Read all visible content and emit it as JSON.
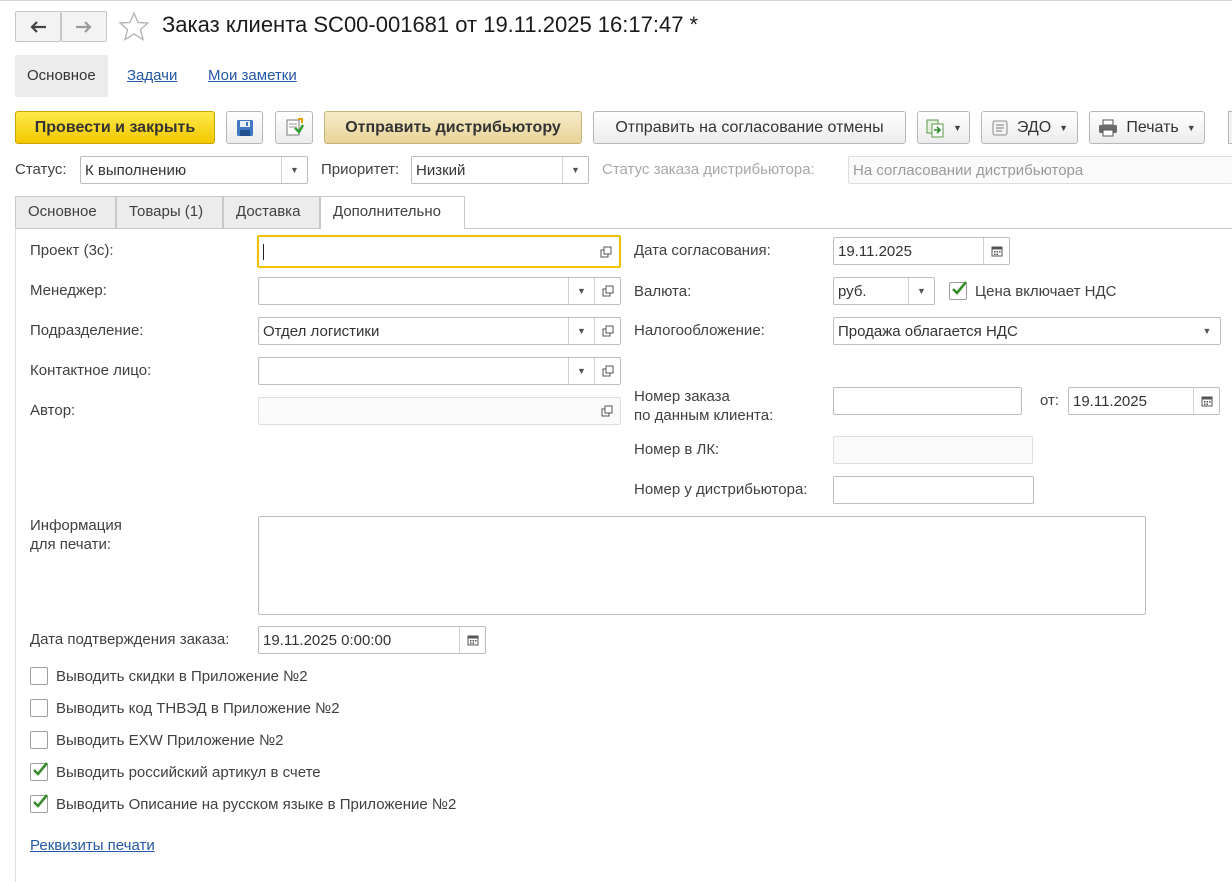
{
  "window": {
    "title": "Заказ клиента SC00-001681 от 19.11.2025 16:17:47 *"
  },
  "nav": {
    "back_icon": "arrow-left-icon",
    "forward_icon": "arrow-right-icon",
    "favorite_icon": "star-icon"
  },
  "sections": {
    "main": "Основное",
    "tasks": "Задачи",
    "notes": "Мои заметки"
  },
  "toolbar": {
    "post_close": "Провести и закрыть",
    "send_distributor": "Отправить дистрибьютору",
    "send_cancel_approval": "Отправить на согласование отмены",
    "edo": "ЭДО",
    "print": "Печать"
  },
  "header": {
    "status_label": "Статус:",
    "status_value": "К выполнению",
    "priority_label": "Приоритет:",
    "priority_value": "Низкий",
    "dist_status_label": "Статус заказа дистрибьютора:",
    "dist_status_value": "На согласовании дистрибьютора"
  },
  "tabs": [
    {
      "label": "Основное"
    },
    {
      "label": "Товары (1)"
    },
    {
      "label": "Доставка"
    },
    {
      "label": "Дополнительно"
    }
  ],
  "form": {
    "project_label": "Проект (3с):",
    "project_value": "",
    "manager_label": "Менеджер:",
    "manager_value": "",
    "department_label": "Подразделение:",
    "department_value": "Отдел логистики",
    "contact_label": "Контактное лицо:",
    "contact_value": "",
    "author_label": "Автор:",
    "author_value": "",
    "approval_date_label": "Дата согласования:",
    "approval_date_value": "19.11.2025",
    "currency_label": "Валюта:",
    "currency_value": "руб.",
    "price_incl_vat_label": "Цена включает НДС",
    "price_incl_vat_checked": true,
    "taxation_label": "Налогообложение:",
    "taxation_value": "Продажа облагается НДС",
    "client_order_label_1": "Номер заказа",
    "client_order_label_2": "по данным клиента:",
    "client_order_value": "",
    "from_label": "от:",
    "from_value": "19.11.2025",
    "lk_number_label": "Номер в ЛК:",
    "lk_number_value": "",
    "dist_number_label": "Номер у дистрибьютора:",
    "dist_number_value": "",
    "print_info_label_1": "Информация",
    "print_info_label_2": "для печати:",
    "print_info_value": "",
    "confirm_date_label": "Дата подтверждения заказа:",
    "confirm_date_value": "19.11.2025  0:00:00"
  },
  "checkboxes": [
    {
      "label": "Выводить скидки в Приложение №2",
      "checked": false
    },
    {
      "label": "Выводить код ТНВЭД в Приложение №2",
      "checked": false
    },
    {
      "label": "Выводить EXW Приложение №2",
      "checked": false
    },
    {
      "label": "Выводить российский артикул в счете",
      "checked": true
    },
    {
      "label": "Выводить Описание на русском языке в Приложение №2",
      "checked": true
    }
  ],
  "links": {
    "print_requisites": "Реквизиты печати"
  },
  "colors": {
    "accent_yellow": "#f2c800",
    "link_blue": "#2457a6",
    "check_green": "#3a8a2e"
  }
}
